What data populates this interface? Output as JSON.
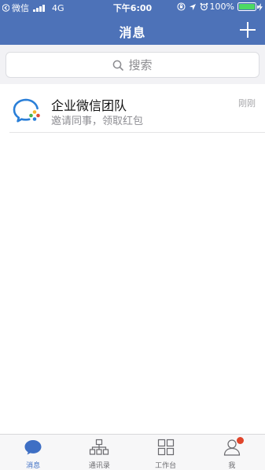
{
  "status_bar": {
    "back_app": "微信",
    "network": "4G",
    "time": "下午6:00",
    "battery": "100%",
    "icons": [
      "back-triangle-icon",
      "signal-bars-icon",
      "orientation-lock-icon",
      "location-arrow-icon",
      "alarm-icon",
      "battery-icon",
      "charging-bolt-icon"
    ]
  },
  "header": {
    "title": "消息",
    "add_icon": "plus-icon",
    "color": "#4d72b8"
  },
  "search": {
    "placeholder": "搜索",
    "icon": "search-icon"
  },
  "conversations": [
    {
      "name": "企业微信团队",
      "preview": "邀请同事，领取红包",
      "time": "刚刚",
      "avatar_icon": "wecom-logo-icon"
    }
  ],
  "tabbar": {
    "active_color": "#3e6fc4",
    "badge_color": "#e0452b",
    "tabs": [
      {
        "label": "消息",
        "icon": "chat-bubble-icon",
        "active": true
      },
      {
        "label": "通讯录",
        "icon": "org-chart-icon",
        "active": false
      },
      {
        "label": "工作台",
        "icon": "grid-icon",
        "active": false
      },
      {
        "label": "我",
        "icon": "person-icon",
        "active": false,
        "badge": true
      }
    ]
  }
}
